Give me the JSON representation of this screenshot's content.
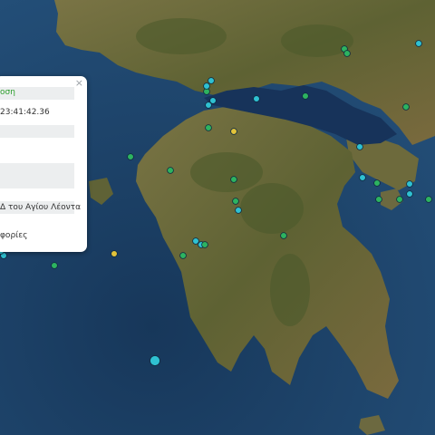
{
  "popup": {
    "title": "οση",
    "time": "23:41:42.36",
    "location": "Δ του Αγίου Λέοντα",
    "more": "φορίες",
    "close_symbol": "×"
  },
  "colors": {
    "sea_deep": "#15314f",
    "sea": "#1f4870",
    "land": "#6f6a3a",
    "land_dark": "#4e5a30",
    "marker_green": "#2db360",
    "marker_cyan": "#2fc1d2",
    "marker_yellow": "#e2c33a"
  },
  "markers": [
    {
      "color": "cyan",
      "size": "normal"
    },
    {
      "color": "green",
      "size": "normal"
    },
    {
      "color": "green",
      "size": "normal"
    },
    {
      "color": "green",
      "size": "normal"
    },
    {
      "color": "cyan",
      "size": "normal"
    },
    {
      "color": "cyan",
      "size": "normal"
    },
    {
      "color": "cyan",
      "size": "normal"
    },
    {
      "color": "cyan",
      "size": "normal"
    },
    {
      "color": "green",
      "size": "normal"
    },
    {
      "color": "yellow",
      "size": "normal"
    },
    {
      "color": "green",
      "size": "normal"
    },
    {
      "color": "green",
      "size": "normal"
    },
    {
      "color": "cyan",
      "size": "normal"
    },
    {
      "color": "green",
      "size": "normal"
    },
    {
      "color": "cyan",
      "size": "normal"
    },
    {
      "color": "green",
      "size": "normal"
    },
    {
      "color": "cyan",
      "size": "normal"
    },
    {
      "color": "green",
      "size": "normal"
    },
    {
      "color": "cyan",
      "size": "normal"
    },
    {
      "color": "green",
      "size": "normal"
    },
    {
      "color": "green",
      "size": "normal"
    },
    {
      "color": "cyan",
      "size": "normal"
    },
    {
      "color": "cyan",
      "size": "normal"
    },
    {
      "color": "cyan",
      "size": "normal"
    },
    {
      "color": "green",
      "size": "normal"
    },
    {
      "color": "green",
      "size": "normal"
    },
    {
      "color": "green",
      "size": "normal"
    },
    {
      "color": "yellow",
      "size": "normal"
    },
    {
      "color": "green",
      "size": "normal"
    },
    {
      "color": "cyan",
      "size": "large"
    },
    {
      "color": "cyan",
      "size": "normal"
    },
    {
      "color": "cyan",
      "size": "normal"
    },
    {
      "color": "green",
      "size": "normal"
    },
    {
      "color": "green",
      "size": "normal"
    },
    {
      "color": "green",
      "size": "normal"
    },
    {
      "color": "cyan",
      "size": "normal"
    }
  ]
}
